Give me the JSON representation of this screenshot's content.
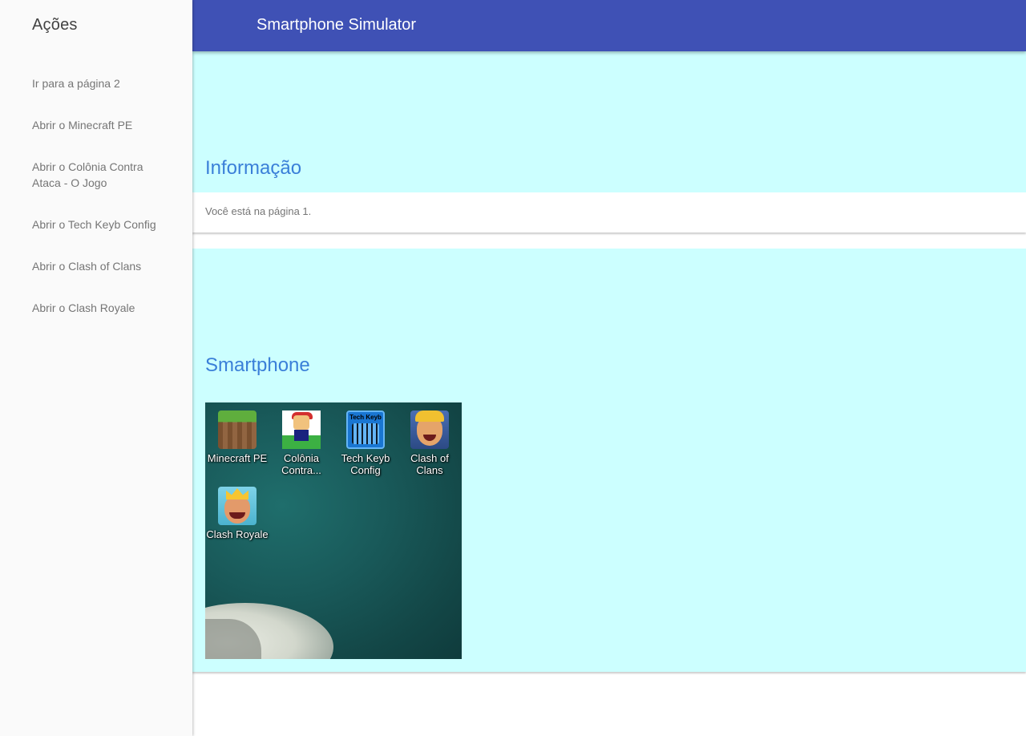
{
  "drawer": {
    "title": "Ações",
    "links": [
      "Ir para a página 2",
      "Abrir o Minecraft PE",
      "Abrir o Colônia Contra Ataca - O Jogo",
      "Abrir o Tech Keyb Config",
      "Abrir o Clash of Clans",
      "Abrir o Clash Royale"
    ]
  },
  "header": {
    "title": "Smartphone Simulator",
    "color": "#3f51b5"
  },
  "info_card": {
    "title": "Informação",
    "text": "Você está na página 1."
  },
  "phone_card": {
    "title": "Smartphone",
    "apps": [
      {
        "label": "Minecraft PE",
        "icon": "minecraft-icon"
      },
      {
        "label": "Colônia Contra...",
        "icon": "colonia-icon"
      },
      {
        "label": "Tech Keyb Config",
        "icon_text": "Tech Keyb",
        "icon": "keyboard-icon"
      },
      {
        "label": "Clash of Clans",
        "icon": "clash-of-clans-icon"
      },
      {
        "label": "Clash Royale",
        "icon": "clash-royale-icon"
      }
    ]
  },
  "colors": {
    "card_bg": "#ccffff",
    "title_text": "#3a7fd8",
    "drawer_bg": "#fafafa"
  }
}
